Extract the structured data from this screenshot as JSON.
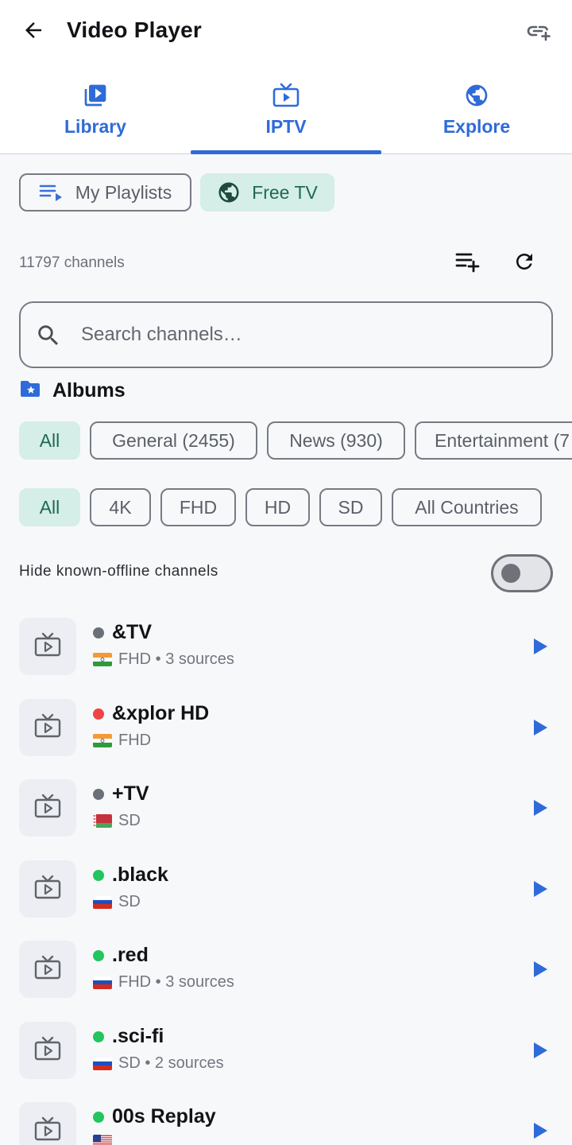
{
  "header": {
    "title": "Video Player",
    "back_icon": "arrow-back-icon",
    "link_icon": "add-link-icon"
  },
  "tabs": [
    {
      "label": "Library",
      "icon": "video-library-icon",
      "selected": false
    },
    {
      "label": "IPTV",
      "icon": "tv-icon",
      "selected": true
    },
    {
      "label": "Explore",
      "icon": "globe-icon",
      "selected": false
    }
  ],
  "sources": {
    "my_playlists": "My Playlists",
    "free_tv": "Free TV",
    "selected": "Free TV"
  },
  "channels_count": "11797 channels",
  "search": {
    "placeholder": "Search channels…",
    "value": ""
  },
  "albums": {
    "title": "Albums",
    "categories": [
      "All",
      "General (2455)",
      "News (930)",
      "Entertainment (7"
    ],
    "selected_category": "All",
    "qualities": [
      "All",
      "4K",
      "FHD",
      "HD",
      "SD",
      "All Countries"
    ],
    "selected_quality": "All"
  },
  "hide_offline": {
    "label": "Hide known-offline channels",
    "enabled": false
  },
  "colors": {
    "accent": "#2f6bd8",
    "chip_selected_bg": "#d5eee7",
    "status_online": "#22c55e",
    "status_offline": "#ef4444",
    "status_unknown": "#6b7078"
  },
  "channels": [
    {
      "name": "&TV",
      "status": "unknown",
      "flag": "India",
      "meta": "FHD • 3 sources"
    },
    {
      "name": "&xplor HD",
      "status": "offline",
      "flag": "India",
      "meta": "FHD"
    },
    {
      "name": "+TV",
      "status": "unknown",
      "flag": "Belarus",
      "meta": "SD"
    },
    {
      "name": ".black",
      "status": "online",
      "flag": "Russia",
      "meta": "SD"
    },
    {
      "name": ".red",
      "status": "online",
      "flag": "Russia",
      "meta": "FHD • 3 sources"
    },
    {
      "name": ".sci-fi",
      "status": "online",
      "flag": "Russia",
      "meta": "SD • 2 sources"
    },
    {
      "name": "00s Replay",
      "status": "online",
      "flag": "USA",
      "meta": ""
    }
  ]
}
